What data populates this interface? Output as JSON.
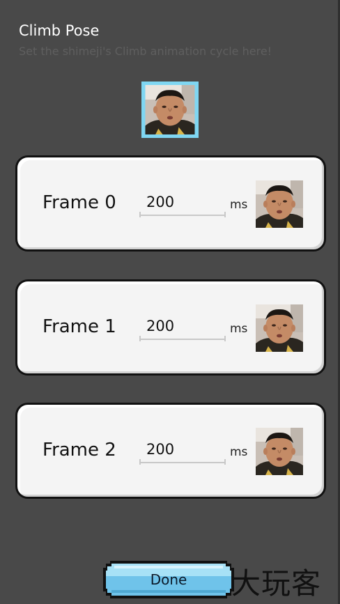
{
  "dialog": {
    "title": "Climb Pose",
    "subtitle": "Set the shimeji's Climb animation cycle here!"
  },
  "preview": {
    "icon": "character-face-icon",
    "border_color": "#7fd6f2"
  },
  "frames": [
    {
      "label": "Frame 0",
      "duration": "200",
      "unit": "ms"
    },
    {
      "label": "Frame 1",
      "duration": "200",
      "unit": "ms"
    },
    {
      "label": "Frame 2",
      "duration": "200",
      "unit": "ms"
    }
  ],
  "actions": {
    "done_label": "Done",
    "done_color": "#7ccbee"
  },
  "watermark": "大玩客",
  "colors": {
    "background": "#494949",
    "card": "#f4f4f4",
    "card_border": "#111111"
  }
}
